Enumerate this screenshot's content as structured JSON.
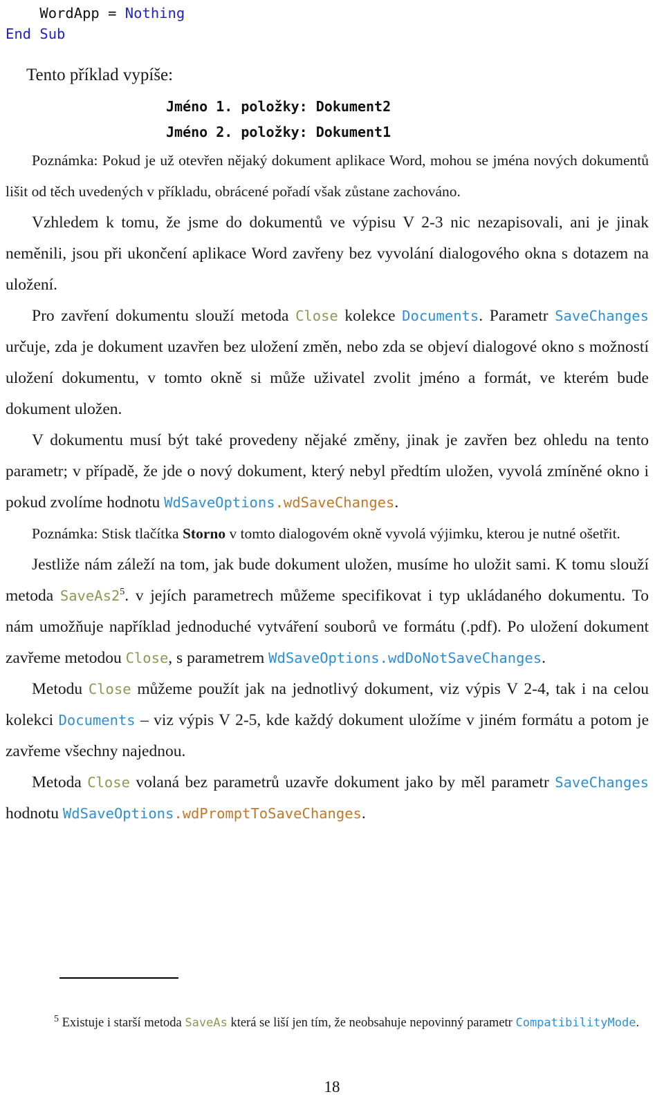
{
  "document": {
    "page_number": "18",
    "colors": {
      "code_keyword_blue": "#2222c8",
      "inline_code_blue": "#2e8fd4",
      "inline_code_olive": "#8a9a55",
      "inline_code_orange": "#c07828",
      "body_text": "#1a1a1a"
    }
  },
  "code_block": {
    "line1_pre": "    WordApp = ",
    "line1_keyword": "Nothing",
    "line2": "End Sub"
  },
  "lead": {
    "text": "Tento příklad vypíše:"
  },
  "console_output": {
    "lines": [
      "Jméno 1. položky: Dokument2",
      "Jméno 2. položky: Dokument1"
    ]
  },
  "paragraphs": {
    "note1": {
      "t1": "Poznámka: Pokud je už otevřen nějaký dokument aplikace Word, mohou se jména nových dokumentů lišit od těch uvedených v příkladu, obrácené pořadí však zůstane zachováno."
    },
    "p2": {
      "t1": "Vzhledem k tomu, že jsme do dokumentů ve výpisu V 2-3 nic nezapisovali, ani je jinak neměnili, jsou při ukončení aplikace Word zavřeny bez vyvolání dialogového okna s dotazem na uložení."
    },
    "p3": {
      "t1": "Pro zavření dokumentu slouží metoda ",
      "code1": "Close",
      "t2": " kolekce ",
      "code2": "Documents",
      "t3": ". Parametr ",
      "code3": "SaveChanges",
      "t4": " určuje, zda je dokument uzavřen bez uložení změn, nebo zda se objeví dialogové okno s možností uložení dokumentu, v tomto okně si může uživatel zvolit jméno a formát, ve kterém bude dokument uložen."
    },
    "p4": {
      "t1": "V dokumentu musí být také provedeny nějaké změny, jinak je zavřen bez ohledu na tento parametr; v případě, že jde o nový dokument, který nebyl předtím uložen, vyvolá zmíněné okno i pokud zvolíme hodnotu ",
      "code1": "WdSaveOptions",
      "code2": ".wdSaveChanges",
      "t2": "."
    },
    "note2": {
      "t1": "Poznámka: Stisk tlačítka ",
      "bold1": "Storno",
      "t2": " v tomto dialogovém okně vyvolá výjimku, kterou je nutné ošetřit."
    },
    "p5": {
      "t1": "Jestliže nám záleží na tom, jak bude dokument uložen, musíme ho uložit sami. K tomu slouží metoda ",
      "code1": "SaveAs2",
      "footnote_marker": "5",
      "t2": ". v jejích parametrech můžeme specifikovat i typ ukládaného dokumentu. To nám umožňuje například jednoduché vytváření souborů ve formátu (.pdf). Po uložení dokument zavřeme metodou ",
      "code2": "Close",
      "t3": ", s parametrem ",
      "code3": "WdSaveOptions.wdDoNotSaveChanges",
      "t4": "."
    },
    "p6": {
      "t1": "Metodu ",
      "code1": "Close",
      "t2": " můžeme použít jak na jednotlivý dokument, viz výpis V 2-4, tak i na celou kolekci ",
      "code2": "Documents",
      "t3": " – viz výpis V 2-5, kde každý dokument uložíme v jiném formátu a potom je zavřeme všechny najednou."
    },
    "p7": {
      "t1": "Metoda ",
      "code1": "Close",
      "t2": " volaná bez parametrů uzavře dokument jako by měl parametr ",
      "code2": "SaveChanges",
      "t3": " hodnotu ",
      "code3": "WdSaveOptions",
      "code4": ".wdPromptToSaveChanges",
      "t4": "."
    }
  },
  "footnote": {
    "marker": "5",
    "t1": " Existuje i starší metoda ",
    "code1": "SaveAs",
    "t2": " která se liší jen tím, že neobsahuje nepovinný parametr ",
    "code2": "CompatibilityMode",
    "t3": "."
  }
}
